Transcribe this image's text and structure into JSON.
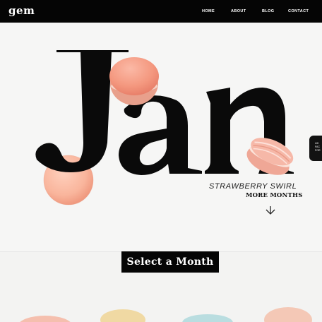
{
  "header": {
    "logo": "gem",
    "nav": [
      "HOME",
      "ABOUT",
      "BLOG",
      "CONTACT"
    ]
  },
  "hero": {
    "month": "Jan",
    "flavor": "STRAWBERRY SWIRL",
    "more_months": "MORE MONTHS",
    "side_tab_lines": [
      "LIK",
      "FAC",
      "FOR"
    ]
  },
  "section": {
    "select_label": "Select a Month"
  },
  "colors": {
    "background": "#f6f6f5",
    "topbar": "#050505",
    "text": "#111111",
    "macaron_pink": "#f4a08a",
    "macaron_peach": "#f9b89f",
    "macaron_striped": "#f3b9ad",
    "macaron_yellow": "#f1dca5",
    "macaron_mint": "#b9dde0"
  },
  "icons": {
    "more_months": "arrow-down-icon"
  }
}
